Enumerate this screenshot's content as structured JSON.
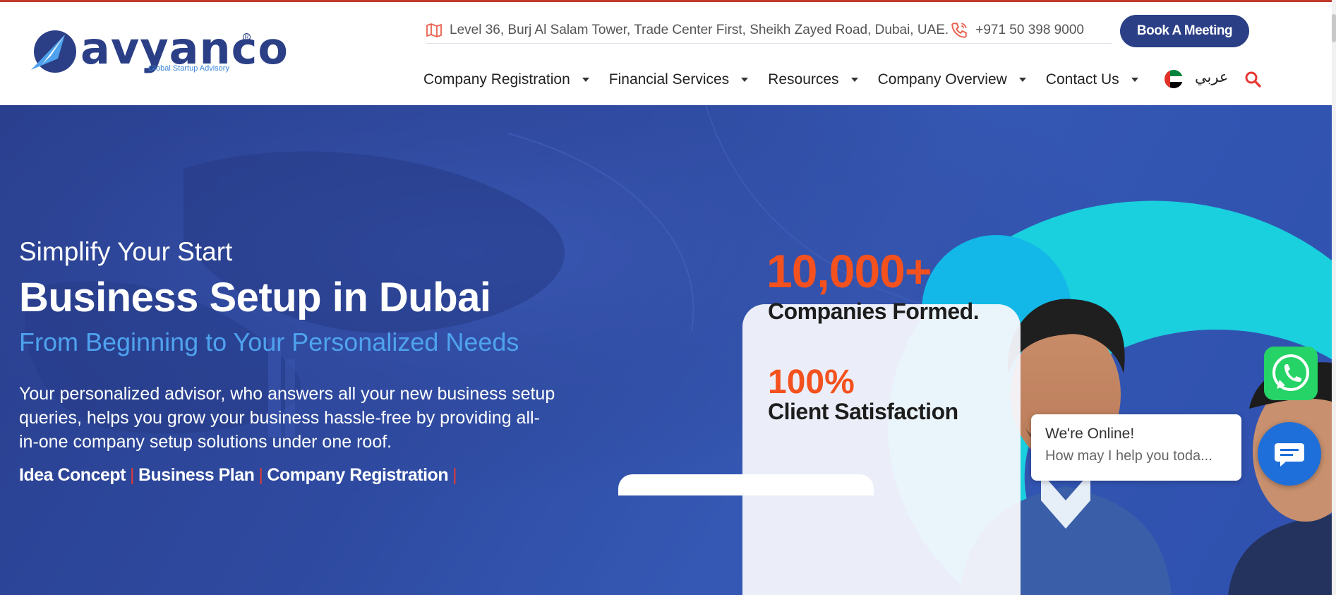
{
  "brand": {
    "name": "avyanco",
    "tagline": "Global Startup Advisory",
    "registered": "R"
  },
  "topbar": {
    "address": "Level 36, Burj Al Salam Tower, Trade Center First, Sheikh Zayed Road, Dubai, UAE.",
    "phone": "+971 50 398 9000",
    "cta_label": "Book A Meeting"
  },
  "nav": {
    "items": [
      {
        "label": "Company Registration"
      },
      {
        "label": "Financial Services"
      },
      {
        "label": "Resources"
      },
      {
        "label": "Company Overview"
      },
      {
        "label": "Contact Us"
      }
    ],
    "language": "عربي"
  },
  "hero": {
    "subtitle": "Simplify Your Start",
    "title": "Business Setup in Dubai",
    "tagline": "From Beginning to Your Personalized Needs",
    "description": "Your personalized advisor, who answers all your new business setup queries, helps you grow your business hassle-free by providing all-in-one company setup solutions under one roof.",
    "services": [
      "Idea Concept",
      "Business Plan",
      "Company Registration"
    ],
    "separator": "|"
  },
  "stats": {
    "companies_value": "10,000+",
    "companies_label": "Companies Formed.",
    "satisfaction_value": "100%",
    "satisfaction_label": "Client Satisfaction"
  },
  "chat": {
    "title": "We're Online!",
    "subtitle": "How may I help you toda..."
  },
  "colors": {
    "brand_navy": "#2b3f86",
    "accent_orange": "#f4511e",
    "accent_red": "#e53935",
    "link_blue": "#4fa3ee",
    "whatsapp_green": "#25d366",
    "chat_blue": "#1e6fd9"
  },
  "icons": {
    "address": "map-icon",
    "phone": "phone-icon",
    "search": "search-icon",
    "nav_dropdown": "chevron-down-icon",
    "language": "uae-flag-icon",
    "whatsapp": "whatsapp-icon",
    "chat": "chat-icon"
  }
}
